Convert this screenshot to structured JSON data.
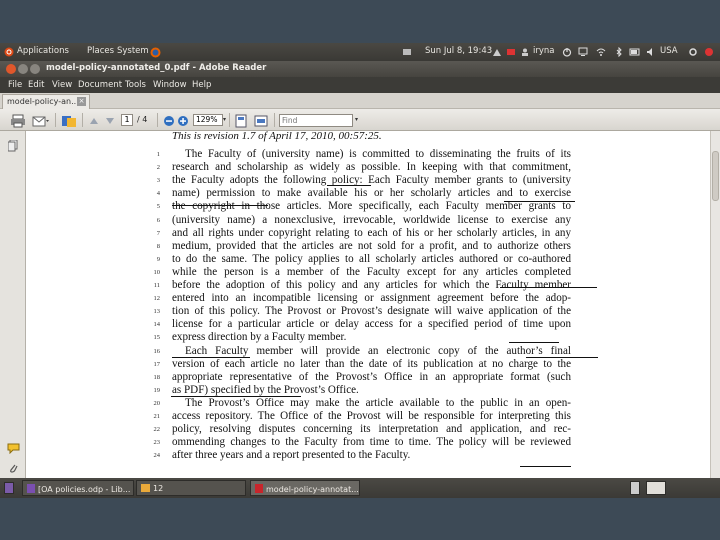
{
  "panel": {
    "applications": "Applications",
    "places": "Places",
    "system": "System",
    "clock": "Sun Jul 8, 19:43",
    "user": "iryna",
    "keyboard": "USA"
  },
  "window": {
    "title": "model-policy-annotated_0.pdf - Adobe Reader"
  },
  "menubar": {
    "items": [
      "File",
      "Edit",
      "View",
      "Document",
      "Tools",
      "Window",
      "Help"
    ]
  },
  "tab": {
    "label": "model-policy-an..."
  },
  "toolbar": {
    "page_current": "1",
    "page_total": "/ 4",
    "zoom": "129%",
    "find_placeholder": "Find"
  },
  "document": {
    "revision": "This is revision 1.7 of April 17, 2010, 00:57:25.",
    "lines": [
      {
        "n": "1",
        "t": "The Faculty of (university name) is committed to disseminating the fruits of its"
      },
      {
        "n": "2",
        "t": "research and scholarship as widely as possible. In keeping with that commitment,"
      },
      {
        "n": "3",
        "t": "the Faculty adopts the following policy: Each Faculty member grants to (university"
      },
      {
        "n": "4",
        "t": "name) permission to make available his or her scholarly articles and to exercise"
      },
      {
        "n": "5",
        "t": "the copyright in those articles. More specifically, each Faculty member grants to"
      },
      {
        "n": "6",
        "t": "(university name) a nonexclusive, irrevocable, worldwide license to exercise any"
      },
      {
        "n": "7",
        "t": "and all rights under copyright relating to each of his or her scholarly articles, in any"
      },
      {
        "n": "8",
        "t": "medium, provided that the articles are not sold for a profit, and to authorize others"
      },
      {
        "n": "9",
        "t": "to do the same. The policy applies to all scholarly articles authored or co-authored"
      },
      {
        "n": "10",
        "t": "while the person is a member of the Faculty except for any articles completed"
      },
      {
        "n": "11",
        "t": "before the adoption of this policy and any articles for which the Faculty member"
      },
      {
        "n": "12",
        "t": "entered into an incompatible licensing or assignment agreement before the adop-"
      },
      {
        "n": "13",
        "t": "tion of this policy. The Provost or Provost’s designate will waive application of the"
      },
      {
        "n": "14",
        "t": "license for a particular article or delay access for a specified period of time upon"
      },
      {
        "n": "15",
        "t": "express direction by a Faculty member."
      },
      {
        "n": "16",
        "t": "Each Faculty member will provide an electronic copy of the author’s final"
      },
      {
        "n": "17",
        "t": "version of each article no later than the date of its publication at no charge to the"
      },
      {
        "n": "18",
        "t": "appropriate representative of the Provost’s Office in an appropriate format (such"
      },
      {
        "n": "19",
        "t": "as PDF) specified by the Provost’s Office."
      },
      {
        "n": "20",
        "t": "The Provost’s Office may make the article available to the public in an open-"
      },
      {
        "n": "21",
        "t": "access repository. The Office of the Provost will be responsible for interpreting this"
      },
      {
        "n": "22",
        "t": "policy, resolving disputes concerning its interpretation and application, and rec-"
      },
      {
        "n": "23",
        "t": "ommending changes to the Faculty from time to time. The policy will be reviewed"
      },
      {
        "n": "24",
        "t": "after three years and a report presented to the Faculty."
      }
    ]
  },
  "taskbar": {
    "task1": "[OA policies.odp - Lib...",
    "task2": "12",
    "task3": "model-policy-annotat..."
  },
  "colors": {
    "accent_close": "#e0572b",
    "panel_bg": "#3c3b37",
    "page_bg": "#ffffff"
  }
}
